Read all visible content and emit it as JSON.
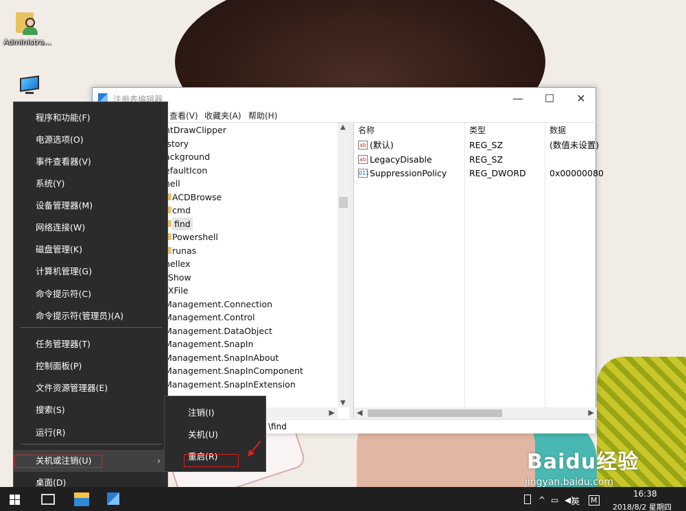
{
  "desktop": {
    "icons": [
      {
        "label": "Administra..."
      },
      {
        "label": ""
      }
    ]
  },
  "regedit": {
    "title": "注册表编辑器",
    "controls": {
      "minimize": "—",
      "maximize": "☐",
      "close": "✕"
    },
    "menu": [
      "查看(V)",
      "收藏夹(A)",
      "帮助(H)"
    ],
    "tree": [
      {
        "name": "ntDrawClipper",
        "folder": false,
        "selected": false
      },
      {
        "name": "istory",
        "folder": false,
        "selected": false
      },
      {
        "name": "ackground",
        "folder": false,
        "selected": false
      },
      {
        "name": "efaultIcon",
        "folder": false,
        "selected": false
      },
      {
        "name": "hell",
        "folder": false,
        "selected": false
      },
      {
        "name": "ACDBrowse",
        "folder": true,
        "selected": false
      },
      {
        "name": "cmd",
        "folder": true,
        "selected": false
      },
      {
        "name": "find",
        "folder": true,
        "selected": true
      },
      {
        "name": "Powershell",
        "folder": true,
        "selected": false
      },
      {
        "name": "runas",
        "folder": true,
        "selected": false
      },
      {
        "name": "hellex",
        "folder": false,
        "selected": false
      },
      {
        "name": "tShow",
        "folder": false,
        "selected": false
      },
      {
        "name": "tXFile",
        "folder": false,
        "selected": false
      },
      {
        "name": "Management.Connection",
        "folder": false,
        "selected": false
      },
      {
        "name": "Management.Control",
        "folder": false,
        "selected": false
      },
      {
        "name": "Management.DataObject",
        "folder": false,
        "selected": false
      },
      {
        "name": "Management.SnapIn",
        "folder": false,
        "selected": false
      },
      {
        "name": "Management.SnapInAbout",
        "folder": false,
        "selected": false
      },
      {
        "name": "Management.SnapInComponent",
        "folder": false,
        "selected": false
      },
      {
        "name": "Management.SnapInExtension",
        "folder": false,
        "selected": false
      }
    ],
    "columns": [
      "名称",
      "类型",
      "数据"
    ],
    "values": [
      {
        "icon": "ab",
        "name": "(默认)",
        "type": "REG_SZ",
        "data": "(数值未设置)"
      },
      {
        "icon": "ab",
        "name": "LegacyDisable",
        "type": "REG_SZ",
        "data": ""
      },
      {
        "icon": "bin",
        "name": "SuppressionPolicy",
        "type": "REG_DWORD",
        "data": "0x00000080"
      }
    ],
    "status": "\\find"
  },
  "winx_menu": {
    "items": [
      {
        "label": "程序和功能(F)"
      },
      {
        "label": "电源选项(O)"
      },
      {
        "label": "事件查看器(V)"
      },
      {
        "label": "系统(Y)"
      },
      {
        "label": "设备管理器(M)"
      },
      {
        "label": "网络连接(W)"
      },
      {
        "label": "磁盘管理(K)"
      },
      {
        "label": "计算机管理(G)"
      },
      {
        "label": "命令提示符(C)"
      },
      {
        "label": "命令提示符(管理员)(A)"
      },
      {
        "label": "任务管理器(T)"
      },
      {
        "label": "控制面板(P)"
      },
      {
        "label": "文件资源管理器(E)"
      },
      {
        "label": "搜索(S)"
      },
      {
        "label": "运行(R)"
      },
      {
        "label": "关机或注销(U)"
      },
      {
        "label": "桌面(D)"
      }
    ],
    "submenu_arrow": "›",
    "submenu": [
      {
        "label": "注销(I)"
      },
      {
        "label": "关机(U)"
      },
      {
        "label": "重启(R)"
      }
    ]
  },
  "taskbar": {
    "ime": "英",
    "ime_mode": "M",
    "time": "16:38",
    "date": "2018/8/2 星期四"
  },
  "watermark": {
    "logo": "Baidu经验",
    "url": "jingyan.baidu.com"
  },
  "colors": {
    "menu_bg": "#2b2b2b",
    "highlight_box": "#e02020",
    "taskbar_bg": "#1f1f1f"
  }
}
